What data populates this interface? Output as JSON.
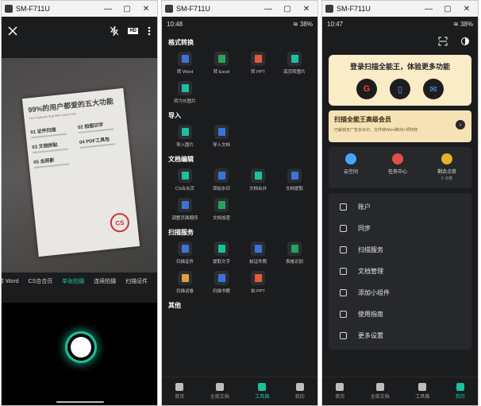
{
  "windows": [
    {
      "title": "SM-F711U",
      "controls": [
        "—",
        "▢",
        "✕"
      ],
      "camera": {
        "doc": {
          "title": "99%的用户都爱的五大功能",
          "subtitle": "The Features that 99% users love",
          "items": [
            "01 证件扫描",
            "02 拍图识字",
            "03 文档拼贴",
            "04 PDF工具包",
            "05 去阴影"
          ],
          "stamp": "CS"
        },
        "modes": [
          "转 Word",
          "CS合合页",
          "单张拍摄",
          "连续拍摄",
          "扫描证件"
        ],
        "active_mode": "单张拍摄"
      }
    },
    {
      "title": "SM-F711U",
      "controls": [
        "—",
        "▢",
        "✕"
      ],
      "status": {
        "time": "10:48",
        "battery": "38%"
      },
      "sections": [
        {
          "title": "格式转换",
          "tools": [
            {
              "label": "转 Word",
              "color": "#3b74d8"
            },
            {
              "label": "转 Excel",
              "color": "#27a35a"
            },
            {
              "label": "转 PPT",
              "color": "#e05b3b"
            },
            {
              "label": "底页转图片",
              "color": "#19c29b"
            },
            {
              "label": "转为长图片",
              "color": "#19c29b"
            }
          ]
        },
        {
          "title": "导入",
          "tools": [
            {
              "label": "导入图片",
              "color": "#19c29b"
            },
            {
              "label": "导入文档",
              "color": "#3b74d8"
            }
          ]
        },
        {
          "title": "文档编辑",
          "tools": [
            {
              "label": "CS合合页",
              "color": "#19c29b"
            },
            {
              "label": "添加水印",
              "color": "#3b74d8"
            },
            {
              "label": "文档合并",
              "color": "#19c29b"
            },
            {
              "label": "文档提取",
              "color": "#3b74d8"
            },
            {
              "label": "调整页面顺序",
              "color": "#3b74d8"
            },
            {
              "label": "文档加密",
              "color": "#27a35a"
            }
          ]
        },
        {
          "title": "扫描服务",
          "tools": [
            {
              "label": "扫描证件",
              "color": "#3b74d8"
            },
            {
              "label": "提取文字",
              "color": "#19c29b"
            },
            {
              "label": "拍证件照",
              "color": "#3b74d8"
            },
            {
              "label": "表格识别",
              "color": "#27a35a"
            },
            {
              "label": "扫描试卷",
              "color": "#e0a03b"
            },
            {
              "label": "扫描书籍",
              "color": "#3b74d8"
            },
            {
              "label": "拍 PPT",
              "color": "#e05b3b"
            }
          ]
        },
        {
          "title": "其他",
          "tools": []
        }
      ],
      "nav": [
        {
          "label": "首页",
          "active": false
        },
        {
          "label": "全部文档",
          "active": false
        },
        {
          "label": "工具箱",
          "active": true
        },
        {
          "label": "我的",
          "active": false
        }
      ]
    },
    {
      "title": "SM-F711U",
      "controls": [
        "—",
        "▢",
        "✕"
      ],
      "status": {
        "time": "10:47",
        "battery": "38%"
      },
      "login": {
        "title": "登录扫描全能王，体验更多功能",
        "icons": [
          {
            "glyph": "G",
            "color": "#ea4335"
          },
          {
            "glyph": "▯",
            "color": "#4aa3ff"
          },
          {
            "glyph": "✉",
            "color": "#4aa3ff"
          }
        ]
      },
      "vip": {
        "title": "扫描全能王高级会员",
        "desc": "已解锁无广告去水印、文件转Word等20+项特权",
        "arrow": "›"
      },
      "quick": [
        {
          "label": "云空间",
          "sub": "",
          "color": "#4aa3ff"
        },
        {
          "label": "任务中心",
          "sub": "",
          "color": "#e0504a"
        },
        {
          "label": "剩余点券",
          "sub": "0 点券",
          "color": "#e6b12a"
        }
      ],
      "menu": [
        "账户",
        "同步",
        "扫描服务",
        "文档管理",
        "添加小组件",
        "使用指南",
        "更多设置"
      ],
      "nav": [
        {
          "label": "首页",
          "active": false
        },
        {
          "label": "全部文档",
          "active": false
        },
        {
          "label": "工具箱",
          "active": false
        },
        {
          "label": "我的",
          "active": true
        }
      ]
    }
  ]
}
